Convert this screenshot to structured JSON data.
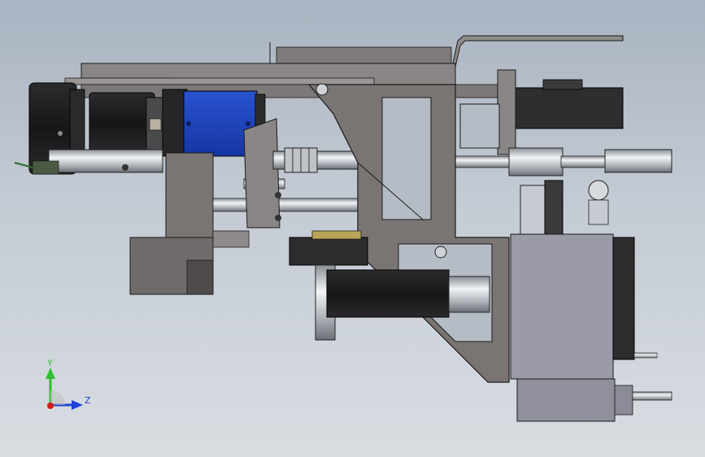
{
  "viewport": {
    "background_top": "#a9b3c1",
    "background_bottom": "#d9dde2",
    "model_colors": {
      "frame_gray": "#7a7573",
      "dark_gray": "#3c3c3e",
      "black": "#141414",
      "steel": "#c9cdd3",
      "motor_blue": "#1d43b8",
      "edge": "#1a1a1a"
    }
  },
  "triad": {
    "y_label": "Y",
    "z_label": "Z",
    "y_color": "#2fbf2f",
    "z_color": "#1c3fd9",
    "x_color": "#d11b1b"
  }
}
